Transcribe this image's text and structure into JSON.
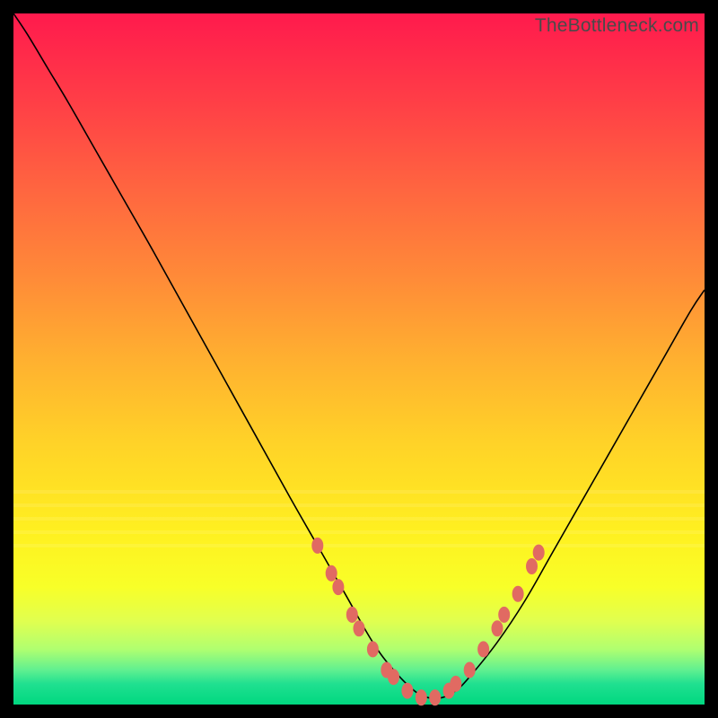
{
  "watermark": "TheBottleneck.com",
  "colors": {
    "curve": "#000000",
    "dot": "#e16a62",
    "background_top": "#ff1a4d",
    "background_bottom": "#00d880"
  },
  "chart_data": {
    "type": "line",
    "title": "",
    "xlabel": "",
    "ylabel": "",
    "xlim": [
      0,
      100
    ],
    "ylim": [
      0,
      100
    ],
    "x": [
      0,
      2,
      5,
      8,
      12,
      16,
      20,
      25,
      30,
      35,
      40,
      44,
      48,
      52,
      55,
      58,
      60,
      62,
      64,
      66,
      70,
      74,
      78,
      82,
      86,
      90,
      94,
      98,
      100
    ],
    "y": [
      100,
      97,
      92,
      87,
      80,
      73,
      66,
      57,
      48,
      39,
      30,
      23,
      16,
      9,
      5,
      2,
      1,
      1,
      2,
      4,
      9,
      15,
      22,
      29,
      36,
      43,
      50,
      57,
      60
    ],
    "annotations": {
      "dots": [
        {
          "x": 44,
          "y": 23
        },
        {
          "x": 46,
          "y": 19
        },
        {
          "x": 47,
          "y": 17
        },
        {
          "x": 49,
          "y": 13
        },
        {
          "x": 50,
          "y": 11
        },
        {
          "x": 52,
          "y": 8
        },
        {
          "x": 54,
          "y": 5
        },
        {
          "x": 55,
          "y": 4
        },
        {
          "x": 57,
          "y": 2
        },
        {
          "x": 59,
          "y": 1
        },
        {
          "x": 61,
          "y": 1
        },
        {
          "x": 63,
          "y": 2
        },
        {
          "x": 64,
          "y": 3
        },
        {
          "x": 66,
          "y": 5
        },
        {
          "x": 68,
          "y": 8
        },
        {
          "x": 70,
          "y": 11
        },
        {
          "x": 71,
          "y": 13
        },
        {
          "x": 73,
          "y": 16
        },
        {
          "x": 75,
          "y": 20
        },
        {
          "x": 76,
          "y": 22
        }
      ],
      "highlight_bands_y": [
        69,
        71,
        73,
        75,
        77
      ]
    }
  }
}
